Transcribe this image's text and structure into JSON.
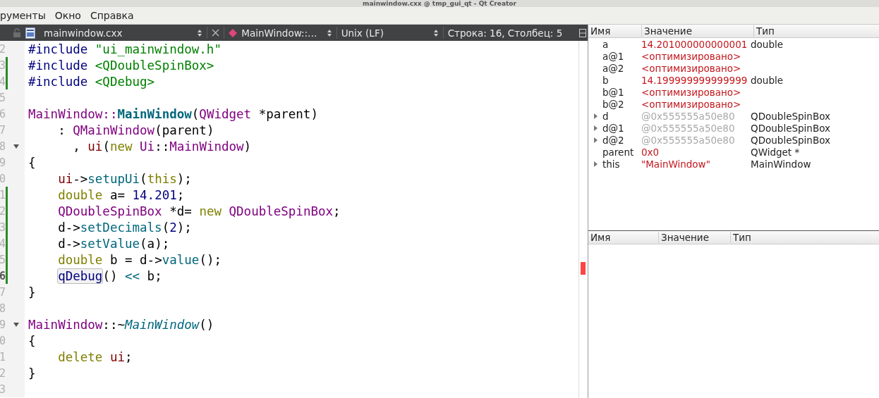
{
  "window": {
    "title": "mainwindow.cxx @ tmp_gui_qt - Qt Creator"
  },
  "menu": [
    "рументы",
    "Окно",
    "Справка"
  ],
  "editor_toolbar": {
    "file_name": "mainwindow.cxx",
    "symbol": "MainWindow::…",
    "line_ending": "Unix (LF)",
    "position": "Строка: 16, Столбец: 5"
  },
  "code_lines": [
    {
      "num": "2",
      "changed": false,
      "current": false,
      "fold": false,
      "tokens": [
        {
          "t": "#include ",
          "color": "#000080",
          "kind": "plain"
        },
        {
          "t": "\"ui_mainwindow.h\"",
          "color": "#008000",
          "kind": "plain"
        }
      ]
    },
    {
      "num": "3",
      "changed": true,
      "current": false,
      "fold": false,
      "tokens": [
        {
          "t": "#include ",
          "color": "#000080",
          "kind": "plain"
        },
        {
          "t": "<QDoubleSpinBox>",
          "color": "#008000",
          "kind": "plain"
        }
      ]
    },
    {
      "num": "4",
      "changed": true,
      "current": false,
      "fold": false,
      "tokens": [
        {
          "t": "#include ",
          "color": "#000080",
          "kind": "plain"
        },
        {
          "t": "<QDebug>",
          "color": "#008000",
          "kind": "plain"
        }
      ]
    },
    {
      "num": "5",
      "changed": false,
      "current": false,
      "fold": false
    },
    {
      "num": "6",
      "changed": false,
      "current": false,
      "fold": false,
      "tokens": [
        {
          "t": "MainWindow::",
          "color": "#800080",
          "kind": "plain"
        },
        {
          "t": "MainWindow",
          "color": "#00677c",
          "kind": "bold"
        },
        {
          "t": "(",
          "color": "#000000",
          "kind": "plain"
        },
        {
          "t": "QWidget",
          "color": "#800080",
          "kind": "plain"
        },
        {
          "t": " *parent)",
          "color": "#000000",
          "kind": "plain"
        }
      ]
    },
    {
      "num": "7",
      "changed": false,
      "current": false,
      "fold": false,
      "tokens": [
        {
          "t": "    : ",
          "color": "#000000",
          "kind": "plain"
        },
        {
          "t": "QMainWindow",
          "color": "#800080",
          "kind": "plain"
        },
        {
          "t": "(parent)",
          "color": "#000000",
          "kind": "plain"
        }
      ]
    },
    {
      "num": "8",
      "changed": false,
      "current": false,
      "fold": true,
      "tokens": [
        {
          "t": "      , ",
          "color": "#000000",
          "kind": "plain"
        },
        {
          "t": "ui",
          "color": "#800000",
          "kind": "plain"
        },
        {
          "t": "(",
          "color": "#000000",
          "kind": "plain"
        },
        {
          "t": "new ",
          "color": "#808000",
          "kind": "plain"
        },
        {
          "t": "Ui",
          "color": "#800080",
          "kind": "plain"
        },
        {
          "t": "::",
          "color": "#000000",
          "kind": "plain"
        },
        {
          "t": "MainWindow",
          "color": "#800080",
          "kind": "plain"
        },
        {
          "t": ")",
          "color": "#000000",
          "kind": "plain"
        }
      ]
    },
    {
      "num": "9",
      "changed": false,
      "current": false,
      "fold": false,
      "tokens": [
        {
          "t": "{",
          "color": "#000000",
          "kind": "plain"
        }
      ]
    },
    {
      "num": "0",
      "changed": false,
      "current": false,
      "fold": false,
      "tokens": [
        {
          "t": "    ui",
          "color": "#800000",
          "kind": "plain"
        },
        {
          "t": "->",
          "color": "#000000",
          "kind": "plain"
        },
        {
          "t": "setupUi",
          "color": "#00677c",
          "kind": "plain"
        },
        {
          "t": "(",
          "color": "#000000",
          "kind": "plain"
        },
        {
          "t": "this",
          "color": "#808000",
          "kind": "plain"
        },
        {
          "t": ");",
          "color": "#000000",
          "kind": "plain"
        }
      ]
    },
    {
      "num": "1",
      "changed": true,
      "current": false,
      "fold": false,
      "tokens": [
        {
          "t": "    double ",
          "color": "#808000",
          "kind": "plain"
        },
        {
          "t": "a= ",
          "color": "#000000",
          "kind": "plain"
        },
        {
          "t": "14.201",
          "color": "#000080",
          "kind": "plain"
        },
        {
          "t": ";",
          "color": "#000000",
          "kind": "plain"
        }
      ]
    },
    {
      "num": "2",
      "changed": true,
      "current": false,
      "fold": false,
      "tokens": [
        {
          "t": "    QDoubleSpinBox",
          "color": "#800080",
          "kind": "plain"
        },
        {
          "t": " *d= ",
          "color": "#000000",
          "kind": "plain"
        },
        {
          "t": "new ",
          "color": "#808000",
          "kind": "plain"
        },
        {
          "t": "QDoubleSpinBox",
          "color": "#800080",
          "kind": "plain"
        },
        {
          "t": ";",
          "color": "#000000",
          "kind": "plain"
        }
      ]
    },
    {
      "num": "3",
      "changed": true,
      "current": false,
      "fold": false,
      "tokens": [
        {
          "t": "    d->",
          "color": "#000000",
          "kind": "plain"
        },
        {
          "t": "setDecimals",
          "color": "#00677c",
          "kind": "plain"
        },
        {
          "t": "(",
          "color": "#000000",
          "kind": "plain"
        },
        {
          "t": "2",
          "color": "#000080",
          "kind": "plain"
        },
        {
          "t": ");",
          "color": "#000000",
          "kind": "plain"
        }
      ]
    },
    {
      "num": "4",
      "changed": true,
      "current": false,
      "fold": false,
      "tokens": [
        {
          "t": "    d->",
          "color": "#000000",
          "kind": "plain"
        },
        {
          "t": "setValue",
          "color": "#00677c",
          "kind": "plain"
        },
        {
          "t": "(a);",
          "color": "#000000",
          "kind": "plain"
        }
      ]
    },
    {
      "num": "5",
      "changed": true,
      "current": false,
      "fold": false,
      "tokens": [
        {
          "t": "    double ",
          "color": "#808000",
          "kind": "plain"
        },
        {
          "t": "b = d->",
          "color": "#000000",
          "kind": "plain"
        },
        {
          "t": "value",
          "color": "#00677c",
          "kind": "plain"
        },
        {
          "t": "();",
          "color": "#000000",
          "kind": "plain"
        }
      ]
    },
    {
      "num": "6",
      "changed": true,
      "current": true,
      "fold": false,
      "tokens": [
        {
          "t": "    qDebug",
          "color": "#000080",
          "kind": "usage"
        },
        {
          "t": "() ",
          "color": "#000000",
          "kind": "plain"
        },
        {
          "t": "<<",
          "color": "#00677c",
          "kind": "plain"
        },
        {
          "t": " b;",
          "color": "#000000",
          "kind": "plain"
        }
      ]
    },
    {
      "num": "7",
      "changed": false,
      "current": false,
      "fold": false,
      "tokens": [
        {
          "t": "}",
          "color": "#000000",
          "kind": "plain"
        }
      ]
    },
    {
      "num": "8",
      "changed": false,
      "current": false,
      "fold": false
    },
    {
      "num": "9",
      "changed": false,
      "current": false,
      "fold": true,
      "tokens": [
        {
          "t": "MainWindow",
          "color": "#800080",
          "kind": "plain"
        },
        {
          "t": "::~",
          "color": "#000000",
          "kind": "plain"
        },
        {
          "t": "MainWindow",
          "color": "#00677c",
          "kind": "italic"
        },
        {
          "t": "()",
          "color": "#000000",
          "kind": "plain"
        }
      ]
    },
    {
      "num": "0",
      "changed": false,
      "current": false,
      "fold": false,
      "tokens": [
        {
          "t": "{",
          "color": "#000000",
          "kind": "plain"
        }
      ]
    },
    {
      "num": "1",
      "changed": false,
      "current": false,
      "fold": false,
      "tokens": [
        {
          "t": "    delete ",
          "color": "#808000",
          "kind": "plain"
        },
        {
          "t": "ui",
          "color": "#800000",
          "kind": "plain"
        },
        {
          "t": ";",
          "color": "#000000",
          "kind": "plain"
        }
      ]
    },
    {
      "num": "2",
      "changed": false,
      "current": false,
      "fold": false,
      "tokens": [
        {
          "t": "}",
          "color": "#000000",
          "kind": "plain"
        }
      ]
    },
    {
      "num": "3",
      "changed": false,
      "current": false,
      "fold": false
    }
  ],
  "locals": {
    "columns": [
      "Имя",
      "Значение",
      "Тип"
    ],
    "rows": [
      {
        "name": "a",
        "value": "14.201000000000001",
        "type": "double",
        "expandable": false,
        "color": "#c4161c"
      },
      {
        "name": "a@1",
        "value": "<оптимизировано>",
        "expandable": false,
        "color": "#c4161c"
      },
      {
        "name": "a@2",
        "value": "<оптимизировано>",
        "expandable": false,
        "color": "#c4161c"
      },
      {
        "name": "b",
        "value": "14.199999999999999",
        "type": "double",
        "expandable": false,
        "color": "#c4161c"
      },
      {
        "name": "b@1",
        "value": "<оптимизировано>",
        "expandable": false,
        "color": "#c4161c"
      },
      {
        "name": "b@2",
        "value": "<оптимизировано>",
        "expandable": false,
        "color": "#c4161c"
      },
      {
        "name": "d",
        "value": "@0x555555a50e80",
        "type": "QDoubleSpinBox",
        "expandable": true,
        "color": "#a8a8a8"
      },
      {
        "name": "d@1",
        "value": "@0x555555a50e80",
        "type": "QDoubleSpinBox",
        "expandable": true,
        "color": "#a8a8a8"
      },
      {
        "name": "d@2",
        "value": "@0x555555a50e80",
        "type": "QDoubleSpinBox",
        "expandable": true,
        "color": "#a8a8a8"
      },
      {
        "name": "parent",
        "value": "0x0",
        "type": "QWidget *",
        "expandable": false,
        "color": "#c4161c"
      },
      {
        "name": "this",
        "value": "\"MainWindow\"",
        "type": "MainWindow",
        "expandable": true,
        "color": "#c4161c"
      }
    ]
  },
  "expressions": {
    "columns": [
      "Имя",
      "Значение",
      "Тип"
    ]
  }
}
